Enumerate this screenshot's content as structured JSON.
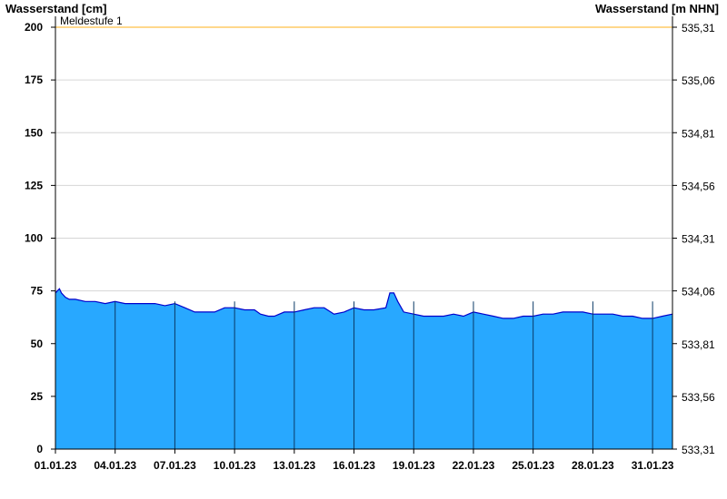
{
  "chart_data": {
    "type": "area",
    "title": "",
    "ylabel_left": "Wasserstand [cm]",
    "ylabel_right": "Wasserstand [m NHN]",
    "ylim": [
      0,
      200
    ],
    "yticks": [
      0,
      25,
      50,
      75,
      100,
      125,
      150,
      175,
      200
    ],
    "yticks_right": [
      "533,31",
      "533,56",
      "533,81",
      "534,06",
      "534,31",
      "534,56",
      "534,81",
      "535,06",
      "535,31"
    ],
    "xlim": [
      0,
      31
    ],
    "xticks": [
      {
        "x": 0,
        "label": "01.01.23"
      },
      {
        "x": 3,
        "label": "04.01.23"
      },
      {
        "x": 6,
        "label": "07.01.23"
      },
      {
        "x": 9,
        "label": "10.01.23"
      },
      {
        "x": 12,
        "label": "13.01.23"
      },
      {
        "x": 15,
        "label": "16.01.23"
      },
      {
        "x": 18,
        "label": "19.01.23"
      },
      {
        "x": 21,
        "label": "22.01.23"
      },
      {
        "x": 24,
        "label": "25.01.23"
      },
      {
        "x": 27,
        "label": "28.01.23"
      },
      {
        "x": 30,
        "label": "31.01.23"
      }
    ],
    "grid": true,
    "reference_lines": [
      {
        "label": "Meldestufe 1",
        "value": 200,
        "color": "#ffcc66"
      }
    ],
    "series": [
      {
        "fill_color": "#28a8ff",
        "line_color": "#0000cc",
        "x": [
          0,
          0.1,
          0.2,
          0.3,
          0.5,
          0.7,
          1.0,
          1.5,
          2.0,
          2.5,
          3.0,
          3.5,
          4.0,
          4.5,
          5.0,
          5.5,
          6.0,
          6.5,
          7.0,
          7.5,
          8.0,
          8.5,
          9.0,
          9.5,
          10.0,
          10.3,
          10.7,
          11.0,
          11.5,
          12.0,
          12.5,
          13.0,
          13.5,
          14.0,
          14.5,
          15.0,
          15.5,
          16.0,
          16.6,
          16.8,
          17.0,
          17.2,
          17.5,
          18.0,
          18.5,
          19.0,
          19.5,
          20.0,
          20.5,
          21.0,
          21.5,
          22.0,
          22.5,
          23.0,
          23.5,
          24.0,
          24.5,
          25.0,
          25.5,
          26.0,
          26.5,
          27.0,
          27.5,
          28.0,
          28.5,
          29.0,
          29.5,
          30.0,
          30.5,
          31.0
        ],
        "y": [
          74,
          75,
          76,
          74,
          72,
          71,
          71,
          70,
          70,
          69,
          70,
          69,
          69,
          69,
          69,
          68,
          69,
          67,
          65,
          65,
          65,
          67,
          67,
          66,
          66,
          64,
          63,
          63,
          65,
          65,
          66,
          67,
          67,
          64,
          65,
          67,
          66,
          66,
          67,
          74,
          74,
          70,
          65,
          64,
          63,
          63,
          63,
          64,
          63,
          65,
          64,
          63,
          62,
          62,
          63,
          63,
          64,
          64,
          65,
          65,
          65,
          64,
          64,
          64,
          63,
          63,
          62,
          62,
          63,
          64
        ]
      }
    ]
  }
}
